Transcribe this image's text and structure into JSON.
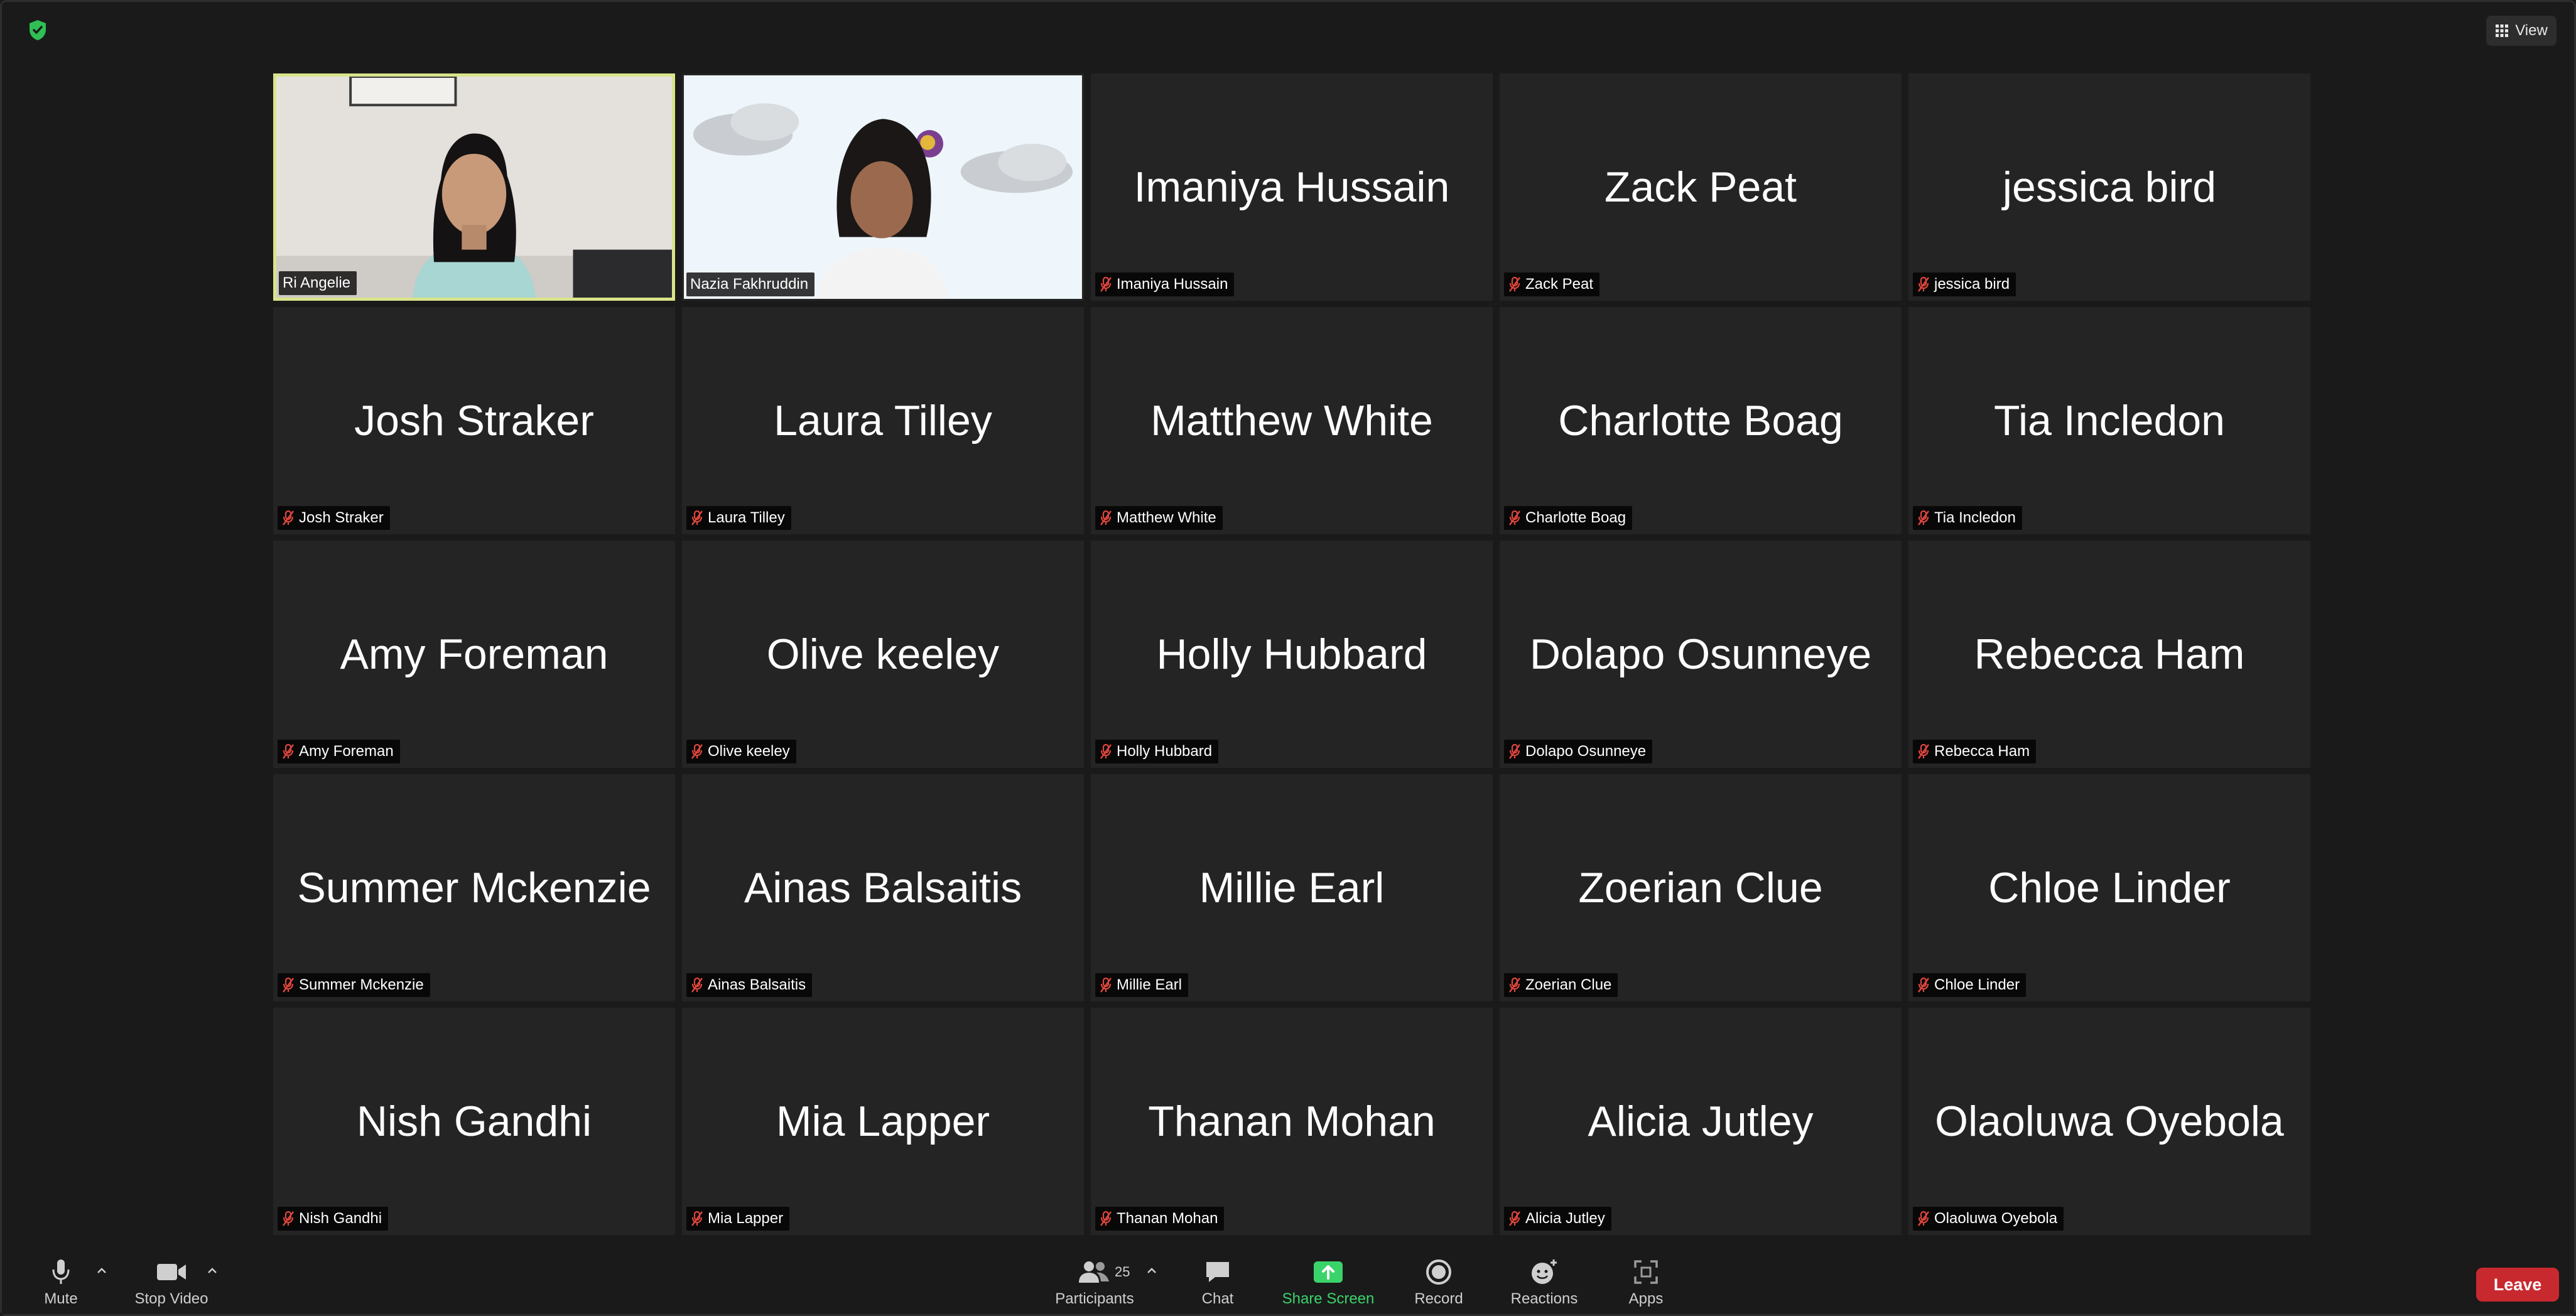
{
  "header": {
    "view_label": "View"
  },
  "participants": [
    {
      "name": "Ri Angelie",
      "video": true,
      "active": true
    },
    {
      "name": "Nazia Fakhruddin",
      "video": true,
      "active": false
    },
    {
      "name": "Imaniya Hussain",
      "video": false
    },
    {
      "name": "Zack Peat",
      "video": false
    },
    {
      "name": "jessica bird",
      "video": false
    },
    {
      "name": "Josh Straker",
      "video": false
    },
    {
      "name": "Laura Tilley",
      "video": false
    },
    {
      "name": "Matthew White",
      "video": false
    },
    {
      "name": "Charlotte Boag",
      "video": false
    },
    {
      "name": "Tia Incledon",
      "video": false
    },
    {
      "name": "Amy Foreman",
      "video": false
    },
    {
      "name": "Olive keeley",
      "video": false
    },
    {
      "name": "Holly Hubbard",
      "video": false
    },
    {
      "name": "Dolapo Osunneye",
      "video": false
    },
    {
      "name": "Rebecca Ham",
      "video": false
    },
    {
      "name": "Summer Mckenzie",
      "video": false
    },
    {
      "name": "Ainas Balsaitis",
      "video": false
    },
    {
      "name": "Millie Earl",
      "video": false
    },
    {
      "name": "Zoerian Clue",
      "video": false
    },
    {
      "name": "Chloe Linder",
      "video": false
    },
    {
      "name": "Nish Gandhi",
      "video": false
    },
    {
      "name": "Mia Lapper",
      "video": false
    },
    {
      "name": "Thanan Mohan",
      "video": false
    },
    {
      "name": "Alicia Jutley",
      "video": false
    },
    {
      "name": "Olaoluwa Oyebola",
      "video": false
    }
  ],
  "toolbar": {
    "mute": "Mute",
    "stop_video": "Stop Video",
    "participants": "Participants",
    "participants_count": "25",
    "chat": "Chat",
    "share_screen": "Share Screen",
    "record": "Record",
    "reactions": "Reactions",
    "apps": "Apps",
    "leave": "Leave"
  },
  "colors": {
    "active_speaker_border": "#d9e48b",
    "share_screen_green": "#3ad36a",
    "leave_red": "#c8292f",
    "muted_icon_red": "#e0463d",
    "tile_bg": "#242424"
  }
}
